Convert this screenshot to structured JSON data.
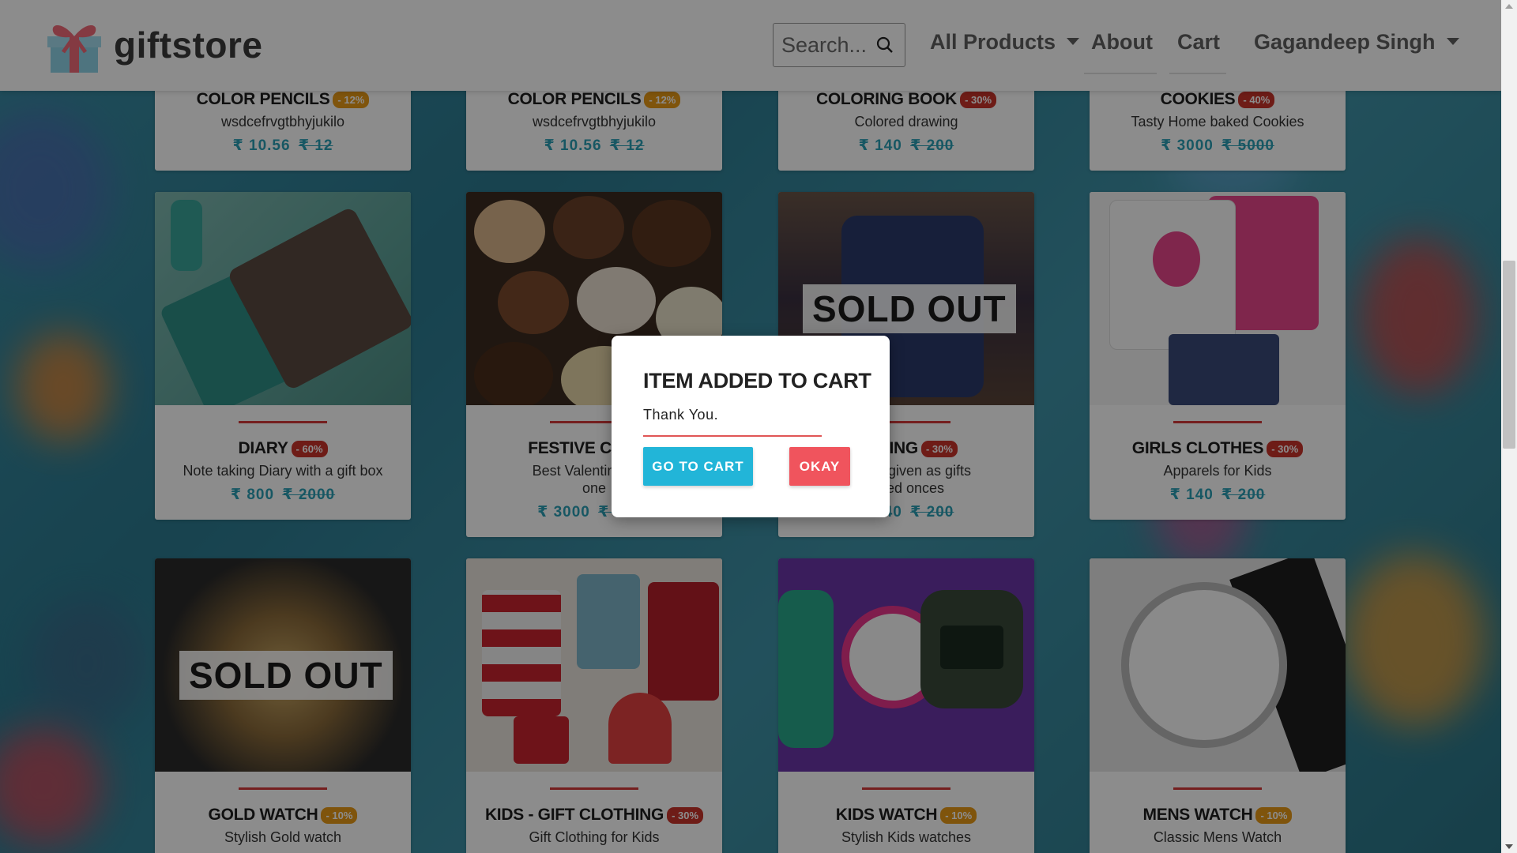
{
  "brand": {
    "name": "giftstore"
  },
  "nav": {
    "search_placeholder": "Search...",
    "all_products": "All Products",
    "about": "About",
    "cart": "Cart",
    "user": "Gagandeep Singh"
  },
  "cards_top": [
    {
      "title": "COLOR PENCILS",
      "discount": "- 12%",
      "desc": "wsdcefrvgtbhyjukilo",
      "price": "₹ 10.56",
      "old_price": "₹ 12"
    },
    {
      "title": "COLOR PENCILS",
      "discount": "- 12%",
      "desc": "wsdcefrvgtbhyjukilo",
      "price": "₹ 10.56",
      "old_price": "₹ 12"
    },
    {
      "title": "COLORING BOOK",
      "discount": "- 30%",
      "desc": "Colored drawing",
      "price": "₹ 140",
      "old_price": "₹ 200"
    },
    {
      "title": "COOKIES",
      "discount": "- 40%",
      "desc": "Tasty Home baked Cookies",
      "price": "₹ 3000",
      "old_price": "₹ 5000"
    }
  ],
  "cards_mid": [
    {
      "title": "DIARY",
      "discount": "- 60%",
      "desc": "Note taking Diary with a gift box",
      "price": "₹ 800",
      "old_price": "₹ 2000"
    },
    {
      "title": "FESTIVE CHOCO",
      "discount": "",
      "desc": "Best Valentines Gift",
      "desc2": "one",
      "price": "₹ 3000",
      "old_price": "₹ 5000"
    },
    {
      "title": "OTHING",
      "discount": "- 30%",
      "desc": "can be given as gifts",
      "desc2": "loved onces",
      "price": "₹ 140",
      "old_price": "₹ 200",
      "sold_label": "SOLD OUT"
    },
    {
      "title": "GIRLS CLOTHES",
      "discount": "- 30%",
      "desc": "Apparels for Kids",
      "price": "₹ 140",
      "old_price": "₹ 200"
    }
  ],
  "cards_bottom": [
    {
      "title": "GOLD WATCH",
      "discount": "- 10%",
      "desc": "Stylish Gold watch",
      "sold_label": "SOLD OUT"
    },
    {
      "title": "KIDS - GIFT CLOTHING",
      "discount": "- 30%",
      "desc": "Gift Clothing for Kids"
    },
    {
      "title": "KIDS WATCH",
      "discount": "- 10%",
      "desc": "Stylish Kids watches"
    },
    {
      "title": "MENS WATCH",
      "discount": "- 10%",
      "desc": "Classic Mens Watch"
    }
  ],
  "modal": {
    "title": "ITEM ADDED TO CART",
    "text": "Thank You.",
    "go_to_cart": "GO TO CART",
    "okay": "OKAY"
  },
  "colors": {
    "accent_teal": "#2a9fb5",
    "divider_red": "#d43a3a",
    "discount_red": "#c9342a",
    "discount_orange": "#e89a16",
    "btn_cart": "#22b5d8",
    "btn_okay": "#f0545d"
  }
}
